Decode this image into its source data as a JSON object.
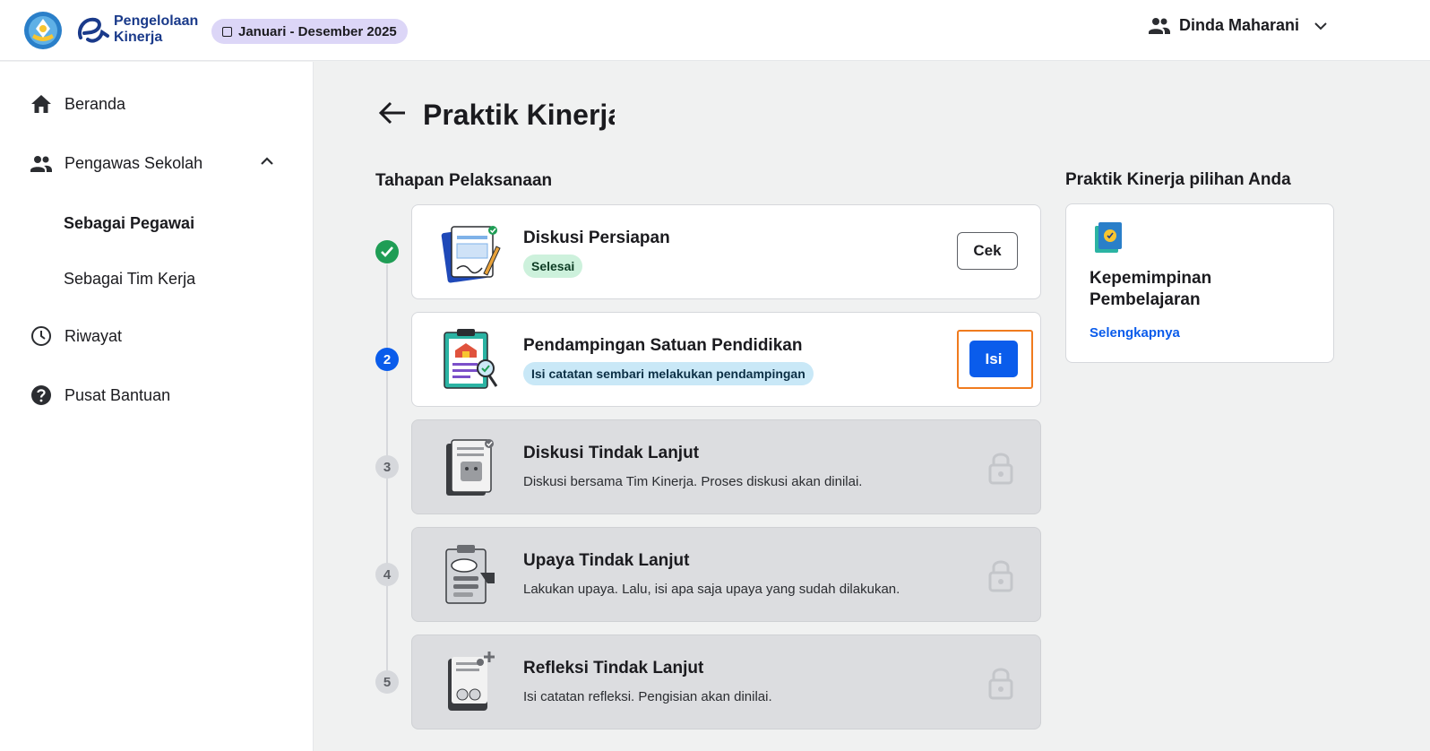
{
  "header": {
    "app_name_line1": "Pengelolaan",
    "app_name_line2": "Kinerja",
    "period": "Januari - Desember 2025",
    "user_name": "Dinda Maharani"
  },
  "sidebar": {
    "items": [
      {
        "label": "Beranda",
        "icon": "home-icon"
      },
      {
        "label": "Pengawas Sekolah",
        "icon": "people-icon"
      },
      {
        "label": "Sebagai Pegawai",
        "active": true
      },
      {
        "label": "Sebagai Tim Kerja"
      },
      {
        "label": "Riwayat",
        "icon": "clock-icon"
      },
      {
        "label": "Pusat Bantuan",
        "icon": "help-icon"
      }
    ]
  },
  "main": {
    "title": "Praktik Kinerja",
    "stages_heading": "Tahapan Pelaksanaan",
    "choice_heading": "Praktik Kinerja pilihan Anda",
    "steps": [
      {
        "number": "",
        "title": "Diskusi Persiapan",
        "badge": "Selesai",
        "button": "Cek",
        "state": "done"
      },
      {
        "number": "2",
        "title": "Pendampingan Satuan Pendidikan",
        "badge": "Isi catatan sembari melakukan pendampingan",
        "button": "Isi",
        "state": "active"
      },
      {
        "number": "3",
        "title": "Diskusi Tindak Lanjut",
        "desc": "Diskusi bersama Tim Kinerja. Proses diskusi akan dinilai.",
        "state": "locked"
      },
      {
        "number": "4",
        "title": "Upaya Tindak Lanjut",
        "desc": "Lakukan upaya. Lalu, isi apa saja upaya yang sudah dilakukan.",
        "state": "locked"
      },
      {
        "number": "5",
        "title": "Refleksi Tindak Lanjut",
        "desc": "Isi catatan refleksi. Pengisian akan dinilai.",
        "state": "locked"
      }
    ],
    "choice": {
      "title": "Kepemimpinan Pembelajaran",
      "link": "Selengkapnya"
    }
  },
  "colors": {
    "primary": "#0a5ceb",
    "focus_outline": "#f07b1e",
    "success": "#1f9d55",
    "period_badge": "#dcd6f7"
  }
}
